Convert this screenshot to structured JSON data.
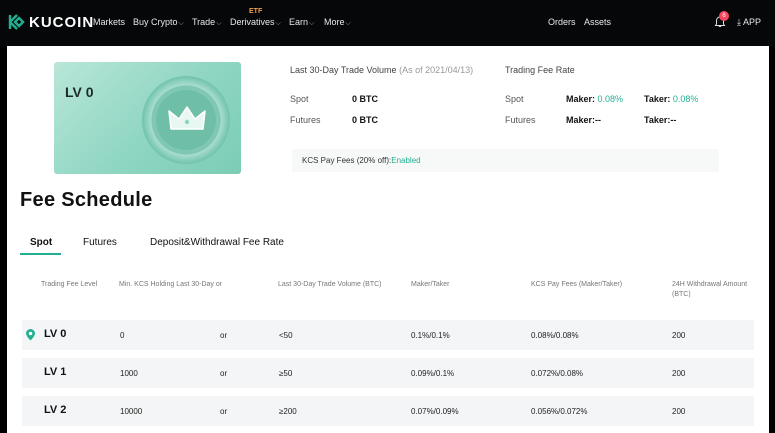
{
  "nav": {
    "brand": "KUCOIN",
    "items": [
      {
        "label": "Markets",
        "chevron": false
      },
      {
        "label": "Buy Crypto",
        "chevron": true
      },
      {
        "label": "Trade",
        "chevron": true
      },
      {
        "label": "Derivatives",
        "chevron": true
      },
      {
        "label": "Earn",
        "chevron": true
      },
      {
        "label": "More",
        "chevron": true
      }
    ],
    "etf_tag": "ETF",
    "orders": "Orders",
    "assets": "Assets",
    "notification_count": "6",
    "app": "APP",
    "chevron_glyph": "⌵"
  },
  "level_card": {
    "level": "LV 0"
  },
  "summary": {
    "volume_title": "Last 30-Day Trade Volume",
    "as_of": "(As of 2021/04/13)",
    "fee_title": "Trading Fee Rate",
    "spot_label": "Spot",
    "spot_volume": "0 BTC",
    "futures_label": "Futures",
    "futures_volume": "0 BTC",
    "maker_label": "Maker:",
    "taker_label": "Taker:",
    "spot_maker": "0.08%",
    "spot_taker": "0.08%",
    "futures_maker": "--",
    "futures_taker": "--",
    "kcs_label": "KCS Pay Fees (20% off):",
    "kcs_status": "Enabled"
  },
  "fee_schedule": {
    "title": "Fee Schedule",
    "tabs": [
      "Spot",
      "Futures",
      "Deposit&Withdrawal Fee Rate"
    ],
    "active_tab": "Spot",
    "columns": [
      "Trading Fee Level",
      "Min. KCS Holding Last 30-Day or",
      "Last 30-Day Trade Volume (BTC)",
      "Maker/Taker",
      "KCS Pay Fees (Maker/Taker)",
      "24H Withdrawal Amount (BTC)"
    ],
    "rows": [
      {
        "level": "LV 0",
        "kcs": "0",
        "or": "or",
        "volume": "<50",
        "maker_taker": "0.1%/0.1%",
        "kcs_fees": "0.08%/0.08%",
        "withdrawal": "200",
        "current": true
      },
      {
        "level": "LV 1",
        "kcs": "1000",
        "or": "or",
        "volume": "≥50",
        "maker_taker": "0.09%/0.1%",
        "kcs_fees": "0.072%/0.08%",
        "withdrawal": "200",
        "current": false
      },
      {
        "level": "LV 2",
        "kcs": "10000",
        "or": "or",
        "volume": "≥200",
        "maker_taker": "0.07%/0.09%",
        "kcs_fees": "0.056%/0.072%",
        "withdrawal": "200",
        "current": false
      }
    ]
  },
  "colors": {
    "accent": "#23af91",
    "nav_bg": "#060708",
    "badge": "#f6465d",
    "etf": "#f0a14a"
  }
}
